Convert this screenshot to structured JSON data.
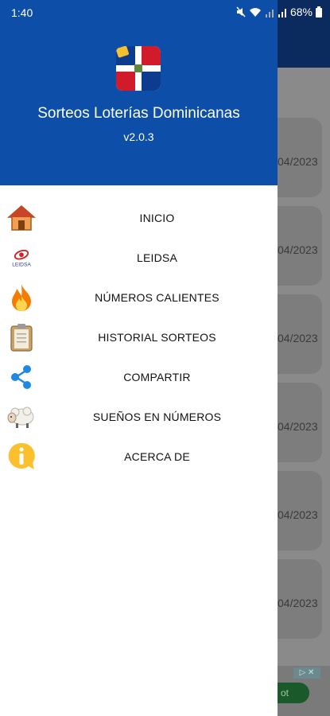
{
  "status_bar": {
    "time": "1:40",
    "battery": "68%"
  },
  "drawer": {
    "app_title": "Sorteos Loterías Dominicanas",
    "version": "v2.0.3",
    "items": [
      {
        "label": "INICIO",
        "icon": "home-icon"
      },
      {
        "label": "LEIDSA",
        "icon": "leidsa-logo-icon",
        "icon_text": "LEIDSA"
      },
      {
        "label": "NÚMEROS CALIENTES",
        "icon": "fire-icon"
      },
      {
        "label": "HISTORIAL SORTEOS",
        "icon": "clipboard-icon"
      },
      {
        "label": "COMPARTIR",
        "icon": "share-icon"
      },
      {
        "label": "SUEÑOS EN NÚMEROS",
        "icon": "sheep-icon"
      },
      {
        "label": "ACERCA DE",
        "icon": "info-icon"
      }
    ]
  },
  "background": {
    "dates": [
      "04/2023",
      "04/2023",
      "04/2023",
      "04/2023",
      "04/2023",
      "04/2023"
    ],
    "ad_button": "ot Now"
  },
  "colors": {
    "drawer_header": "#0d4fa8",
    "app_bar": "#0b2a5e"
  }
}
